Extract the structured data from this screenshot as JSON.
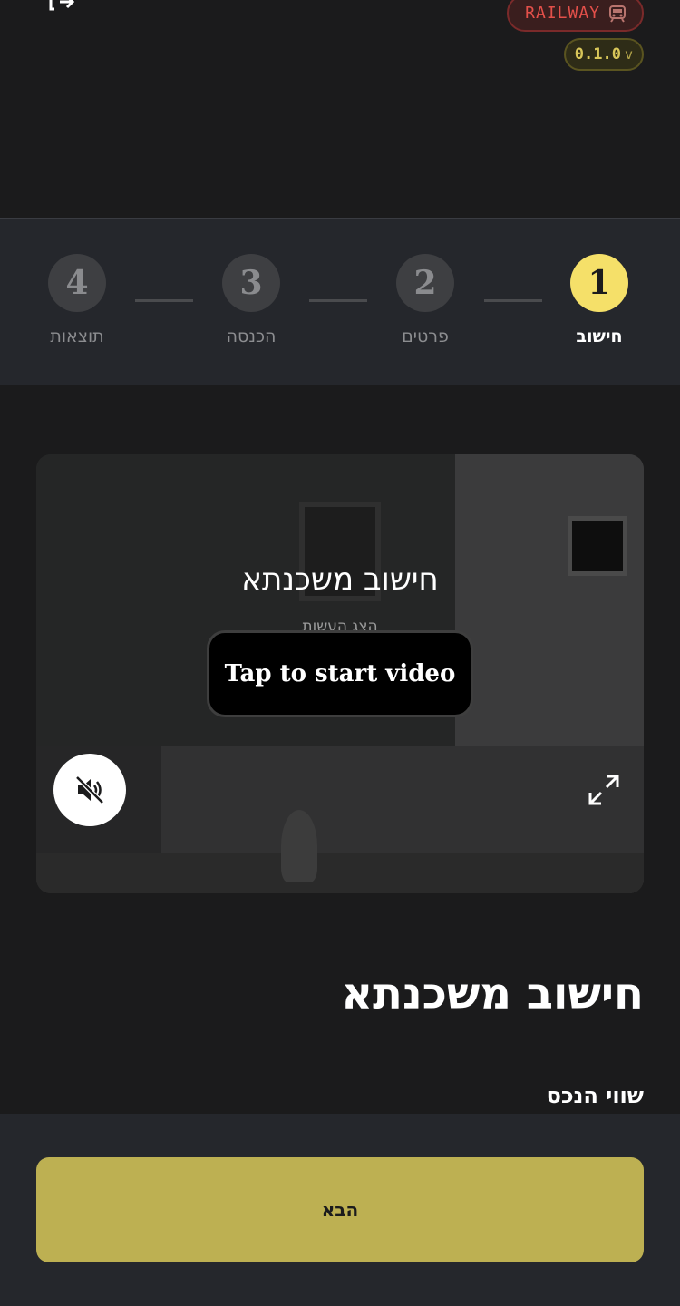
{
  "header": {
    "exit_icon": "exit-icon",
    "railway_badge": {
      "label": "RAILWAY",
      "icon": "train-icon",
      "color": "#e4504a"
    },
    "version": {
      "number": "0.1.0",
      "suffix": "v"
    }
  },
  "stepper": {
    "active_index": 0,
    "accent_color": "#f5e069",
    "steps": [
      {
        "number": "1",
        "label": "חישוב"
      },
      {
        "number": "2",
        "label": "פרטים"
      },
      {
        "number": "3",
        "label": "הכנסה"
      },
      {
        "number": "4",
        "label": "תוצאות"
      }
    ]
  },
  "video": {
    "title": "חישוב משכנתא",
    "subtitle": "הצג העשות",
    "tap_label": "Tap to start video",
    "mute_icon": "volume-muted-icon",
    "fullscreen_icon": "fullscreen-icon"
  },
  "main": {
    "title": "חישוב משכנתא",
    "field_label": "שווי הנכס"
  },
  "footer": {
    "next_label": "הבא",
    "button_color": "#bdb052"
  }
}
